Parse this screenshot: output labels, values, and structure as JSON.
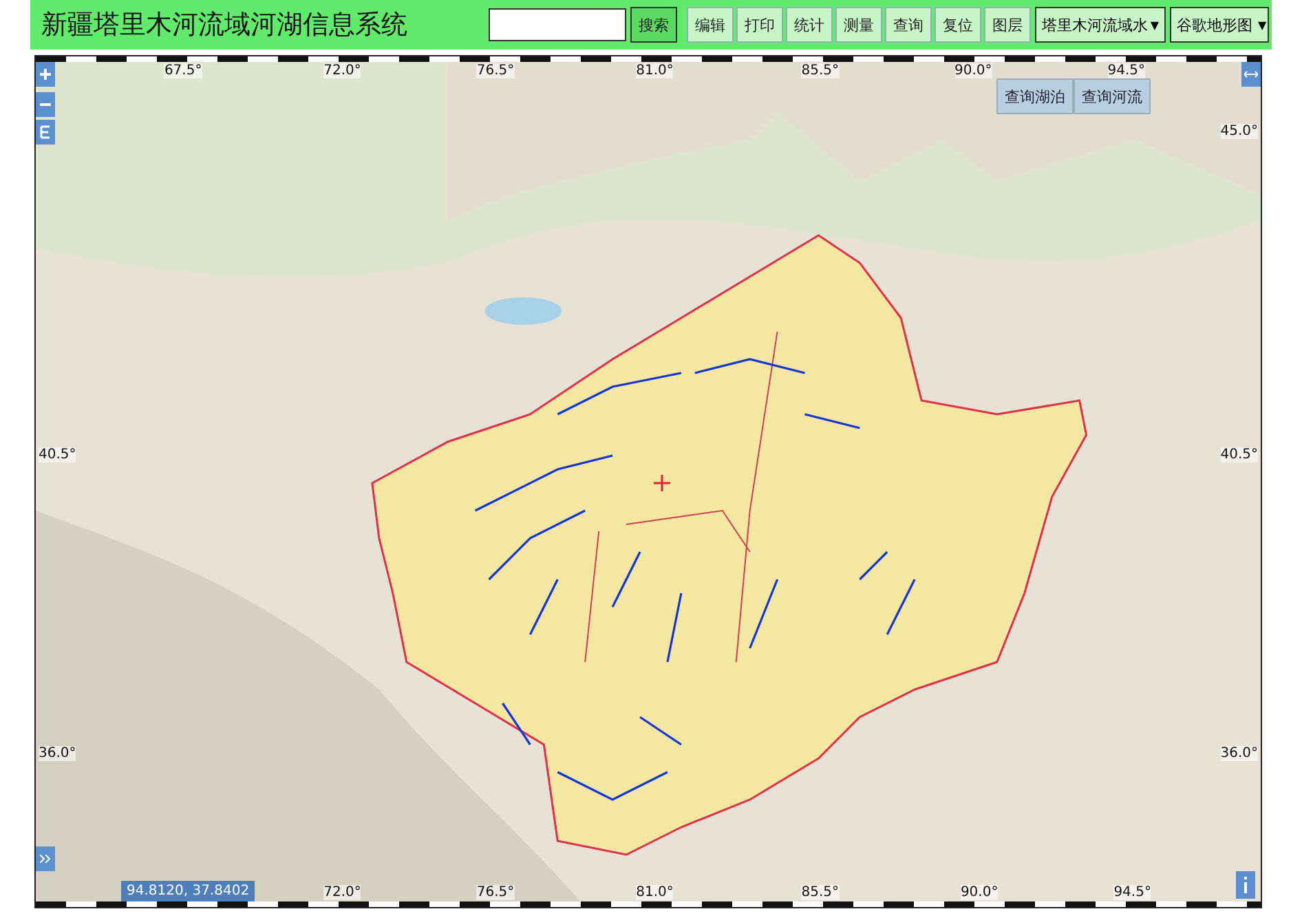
{
  "header": {
    "title": "新疆塔里木河流域河湖信息系统",
    "search_button": "搜索",
    "tools": [
      "编辑",
      "打印",
      "统计",
      "测量",
      "查询",
      "复位",
      "图层"
    ],
    "dropdowns": [
      {
        "value": "塔里木河流域水",
        "caret": "▼"
      },
      {
        "value": "谷歌地形图",
        "caret": "▼"
      }
    ]
  },
  "map": {
    "query_buttons": [
      "查询湖泊",
      "查询河流"
    ],
    "coordinates": "94.8120, 37.8402",
    "graticule": {
      "top": [
        "67.5°",
        "72.0°",
        "76.5°",
        "81.0°",
        "85.5°",
        "90.0°",
        "94.5°"
      ],
      "bottom": [
        "72.0°",
        "76.5°",
        "81.0°",
        "85.5°",
        "90.0°",
        "94.5°"
      ],
      "left": [
        "40.5°",
        "36.0°"
      ],
      "right": [
        "45.0°",
        "40.5°",
        "36.0°"
      ]
    }
  }
}
